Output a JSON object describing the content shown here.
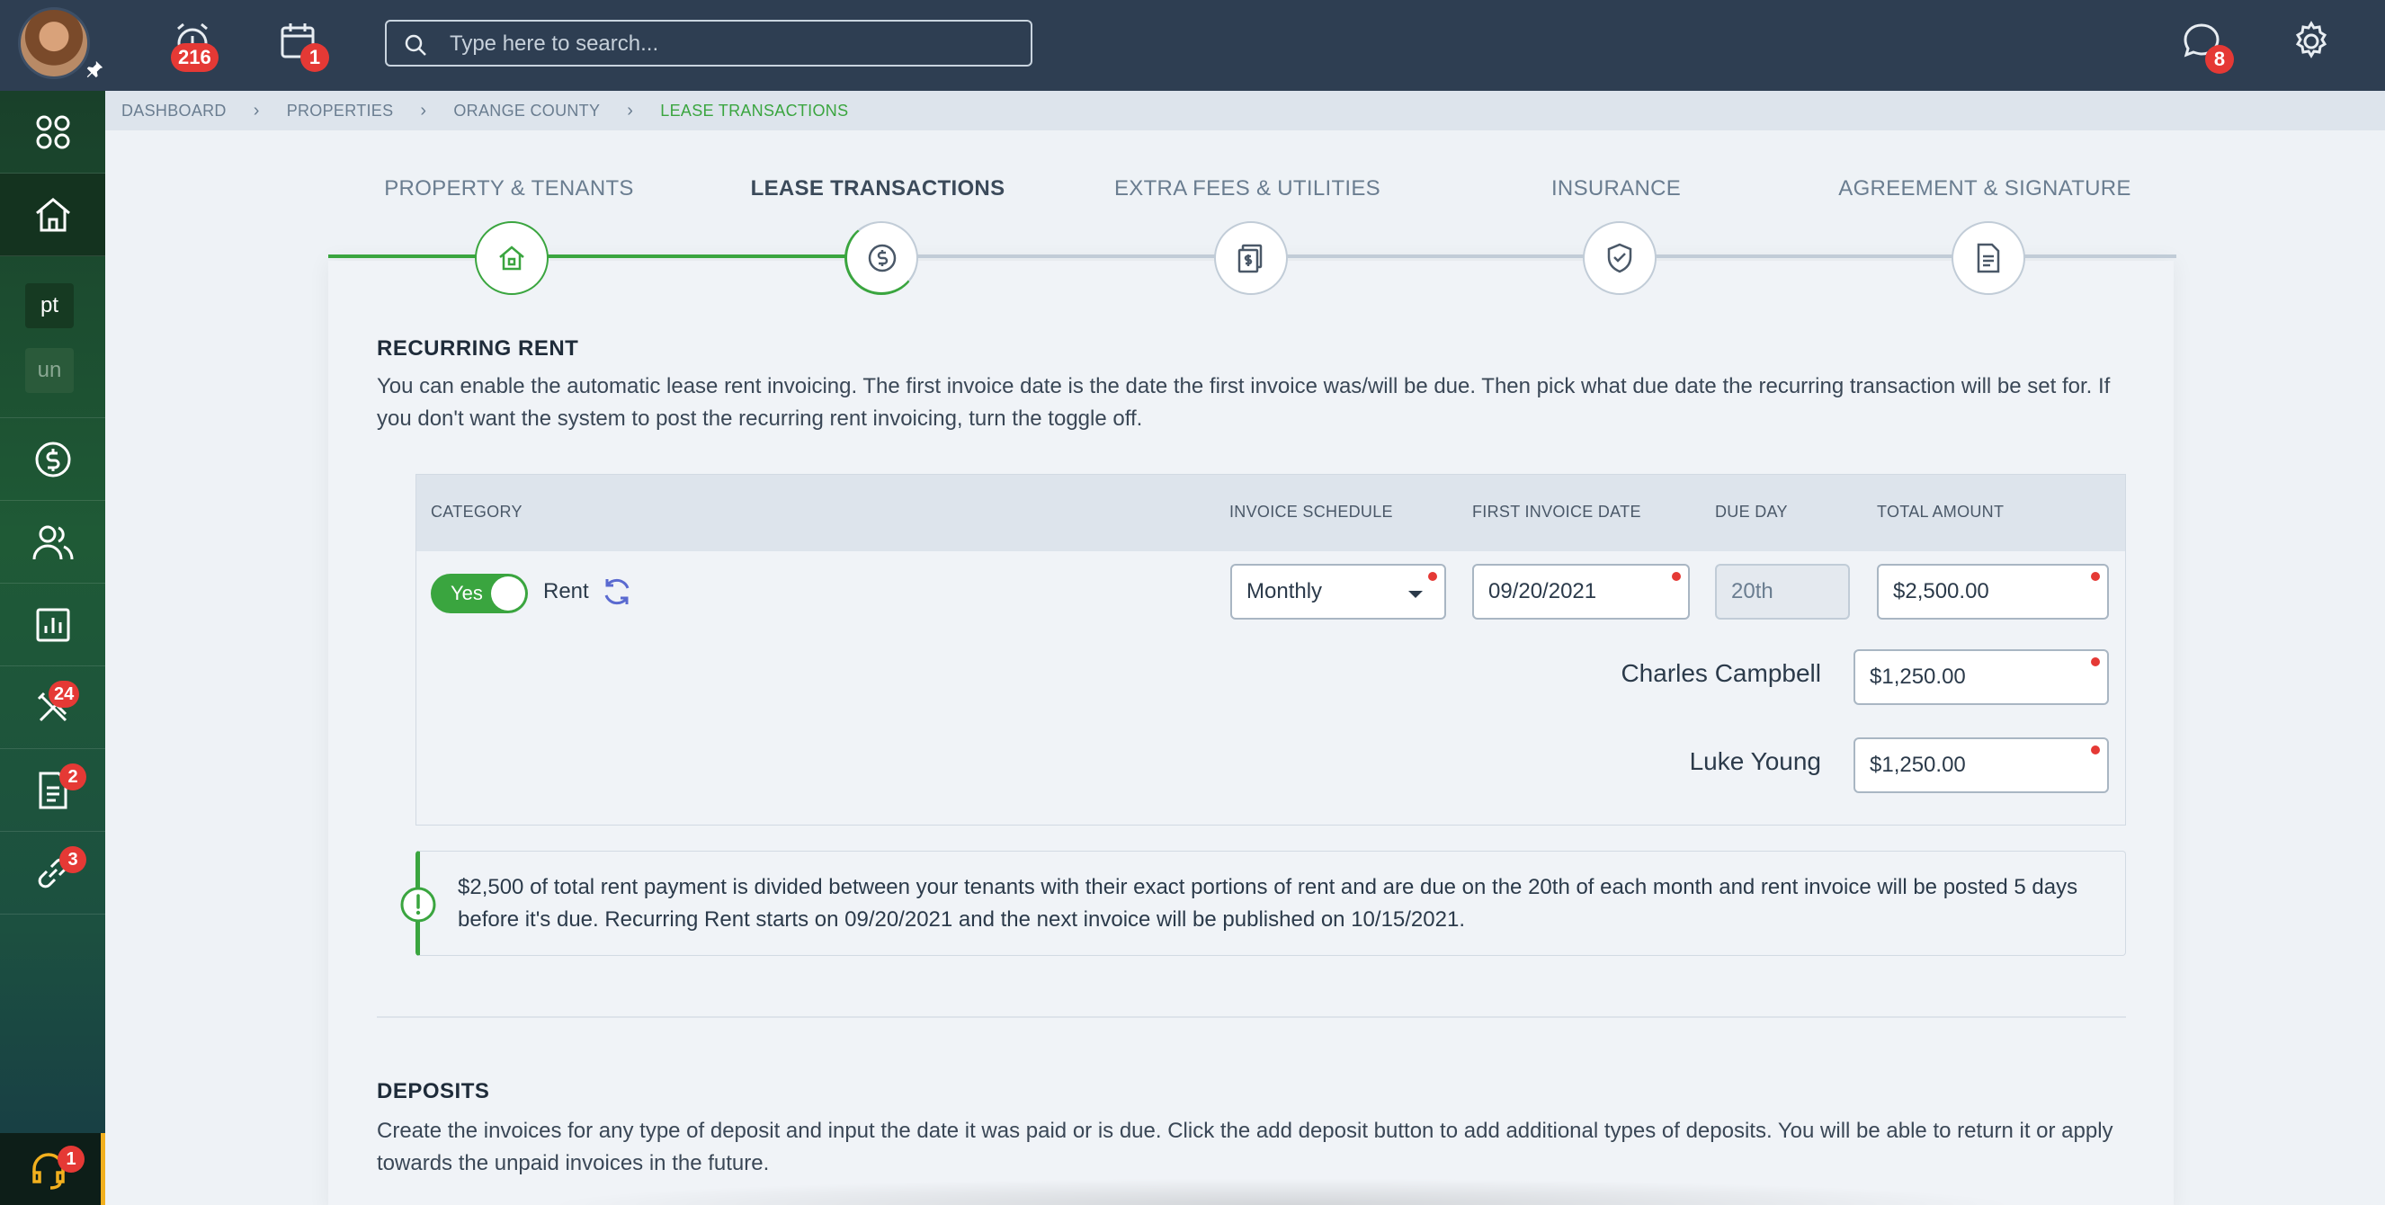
{
  "topbar": {
    "avatar_icon": "user-avatar",
    "alerts_badge": "216",
    "calendar_badge": "1",
    "messages_badge": "8",
    "search": {
      "placeholder": "Type here to search..."
    }
  },
  "sidebar": {
    "chip_pt": "pt",
    "chip_un": "un",
    "maintenance_badge": "24",
    "documents_badge": "2",
    "links_badge": "3",
    "support_badge": "1"
  },
  "breadcrumb": [
    "DASHBOARD",
    "PROPERTIES",
    "ORANGE COUNTY",
    "LEASE TRANSACTIONS"
  ],
  "stepper": {
    "steps": [
      {
        "label": "PROPERTY & TENANTS",
        "icon": "house-icon",
        "state": "done"
      },
      {
        "label": "LEASE TRANSACTIONS",
        "icon": "dollar-circle-icon",
        "state": "current"
      },
      {
        "label": "EXTRA FEES & UTILITIES",
        "icon": "bills-icon",
        "state": "todo"
      },
      {
        "label": "INSURANCE",
        "icon": "shield-check-icon",
        "state": "todo"
      },
      {
        "label": "AGREEMENT & SIGNATURE",
        "icon": "document-icon",
        "state": "todo"
      }
    ]
  },
  "recurring_rent": {
    "title": "RECURRING RENT",
    "description": "You can enable the automatic lease rent invoicing. The first invoice date is the date the first invoice was/will be due. Then pick what due date the recurring transaction will be set for. If you don't want the system to post the recurring rent invoicing, turn the toggle off.",
    "table": {
      "headers": {
        "category": "CATEGORY",
        "schedule": "INVOICE SCHEDULE",
        "first_date": "FIRST INVOICE DATE",
        "due_day": "DUE DAY",
        "total": "TOTAL AMOUNT"
      },
      "toggle_label": "Yes",
      "category_label": "Rent",
      "schedule_value": "Monthly",
      "first_invoice_date": "09/20/2021",
      "due_day": "20th",
      "total_amount": "$2,500.00",
      "tenants": [
        {
          "name": "Charles Campbell",
          "amount": "$1,250.00"
        },
        {
          "name": "Luke Young",
          "amount": "$1,250.00"
        }
      ]
    },
    "info": "$2,500 of total rent payment is divided between your tenants with their exact portions of rent and are due on the 20th of each month and rent invoice will be posted 5 days before it's due. Recurring Rent starts on 09/20/2021 and the next invoice will be published on 10/15/2021."
  },
  "deposits": {
    "title": "DEPOSITS",
    "description": "Create the invoices for any type of deposit and input the date it was paid or is due. Click the add deposit button to add additional types of deposits. You will be able to return it or apply towards the unpaid invoices in the future."
  },
  "colors": {
    "topbar": "#2e3e52",
    "accent_green": "#3aa53f",
    "badge_red": "#e53935",
    "support_accent": "#f2b01e"
  }
}
